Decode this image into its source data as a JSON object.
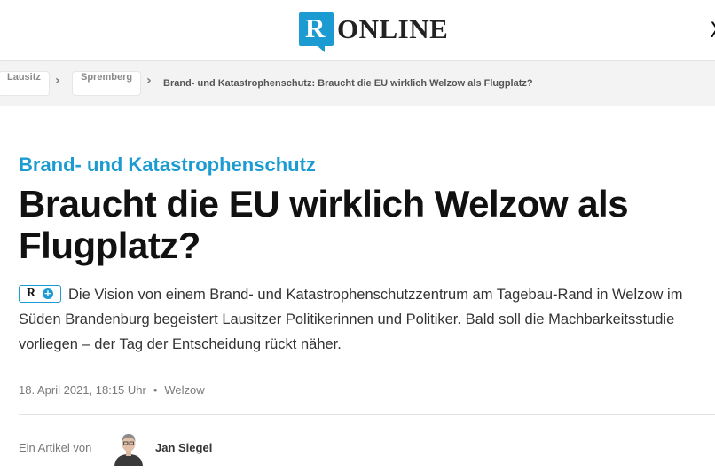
{
  "header": {
    "logo_mark": "R",
    "logo_text": "ONLINE",
    "edge_glyph": "X"
  },
  "breadcrumb": {
    "items": [
      "Lausitz",
      "Spremberg"
    ],
    "separator": "›",
    "current": "Brand- und Katastrophenschutz: Braucht die EU wirklich Welzow als Flugplatz?"
  },
  "article": {
    "kicker": "Brand- und Katastrophenschutz",
    "headline": "Braucht die EU wirklich Welzow als Flugplatz?",
    "badge": {
      "letter": "R",
      "plus": "+"
    },
    "teaser": "Die Vision von einem Brand- und Katastrophenschutzzentrum am Tagebau-Rand in Welzow im Süden Brandenburg begeistert Lausitzer Politikerinnen und Politiker. Bald soll die Machbarkeitsstudie vorliegen – der Tag der Entscheidung rückt näher.",
    "date": "18. April 2021, 18:15 Uhr",
    "meta_separator": "•",
    "location": "Welzow",
    "author_label": "Ein Artikel von",
    "author_name": "Jan Siegel"
  },
  "colors": {
    "accent": "#1b9bd1",
    "breadcrumb_bg": "#f3f3f3",
    "text": "#111111"
  },
  "icons": {
    "logo": "lr-online-logo",
    "plus_badge": "lr-plus-badge",
    "avatar": "author-avatar"
  }
}
